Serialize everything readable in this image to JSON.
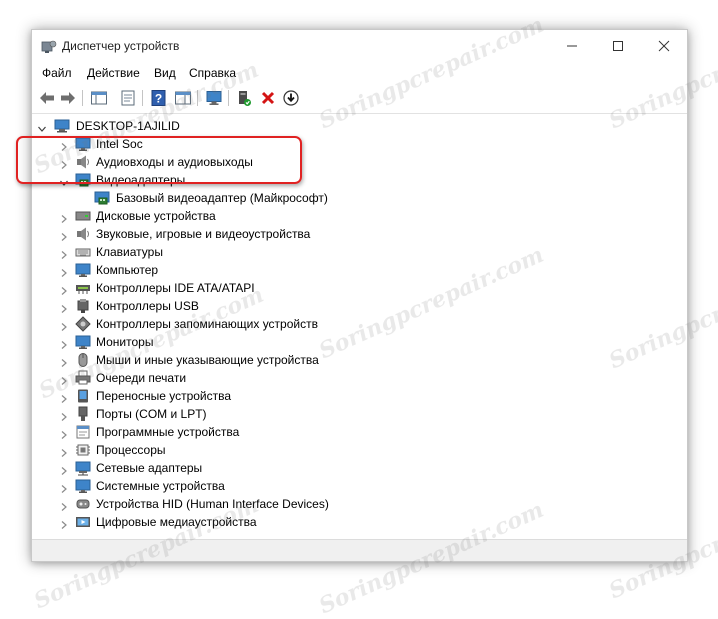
{
  "window": {
    "title": "Диспетчер устройств",
    "controls": {
      "minimize": "minimize",
      "maximize": "maximize",
      "close": "close"
    }
  },
  "menu": [
    "Файл",
    "Действие",
    "Вид",
    "Справка"
  ],
  "toolbar": [
    "back-arrow-icon",
    "forward-arrow-icon",
    "properties-pane-icon",
    "properties-icon",
    "help-icon",
    "details-pane-icon",
    "monitor-scan-icon",
    "enable-device-icon",
    "uninstall-icon",
    "update-driver-icon"
  ],
  "tree": {
    "root": "DESKTOP-1AJILID",
    "categories": [
      {
        "label": "Intel Soc",
        "icon": "monitor-icon",
        "expanded": false
      },
      {
        "label": "Аудиовходы и аудиовыходы",
        "icon": "speaker-icon",
        "expanded": false
      },
      {
        "label": "Видеоадаптеры",
        "icon": "display-adapter-icon",
        "expanded": true,
        "children": [
          {
            "label": "Базовый видеоадаптер (Майкрософт)",
            "icon": "display-adapter-icon"
          }
        ]
      },
      {
        "label": "Дисковые устройства",
        "icon": "disk-icon",
        "expanded": false
      },
      {
        "label": "Звуковые, игровые и видеоустройства",
        "icon": "speaker-icon",
        "expanded": false
      },
      {
        "label": "Клавиатуры",
        "icon": "keyboard-icon",
        "expanded": false
      },
      {
        "label": "Компьютер",
        "icon": "monitor-icon",
        "expanded": false
      },
      {
        "label": "Контроллеры IDE ATA/ATAPI",
        "icon": "ide-controller-icon",
        "expanded": false
      },
      {
        "label": "Контроллеры USB",
        "icon": "usb-icon",
        "expanded": false
      },
      {
        "label": "Контроллеры запоминающих устройств",
        "icon": "storage-controller-icon",
        "expanded": false
      },
      {
        "label": "Мониторы",
        "icon": "monitor-icon",
        "expanded": false
      },
      {
        "label": "Мыши и иные указывающие устройства",
        "icon": "mouse-icon",
        "expanded": false
      },
      {
        "label": "Очереди печати",
        "icon": "printer-icon",
        "expanded": false
      },
      {
        "label": "Переносные устройства",
        "icon": "portable-device-icon",
        "expanded": false
      },
      {
        "label": "Порты (COM и LPT)",
        "icon": "port-icon",
        "expanded": false
      },
      {
        "label": "Программные устройства",
        "icon": "software-device-icon",
        "expanded": false
      },
      {
        "label": "Процессоры",
        "icon": "processor-icon",
        "expanded": false
      },
      {
        "label": "Сетевые адаптеры",
        "icon": "network-adapter-icon",
        "expanded": false
      },
      {
        "label": "Системные устройства",
        "icon": "system-device-icon",
        "expanded": false
      },
      {
        "label": "Устройства HID (Human Interface Devices)",
        "icon": "hid-icon",
        "expanded": false
      },
      {
        "label": "Цифровые медиаустройства",
        "icon": "media-device-icon",
        "expanded": false
      }
    ]
  },
  "watermark": "Soringpcrepair.com",
  "colors": {
    "highlight": "#e02222",
    "folder_arrow": "#404040"
  }
}
